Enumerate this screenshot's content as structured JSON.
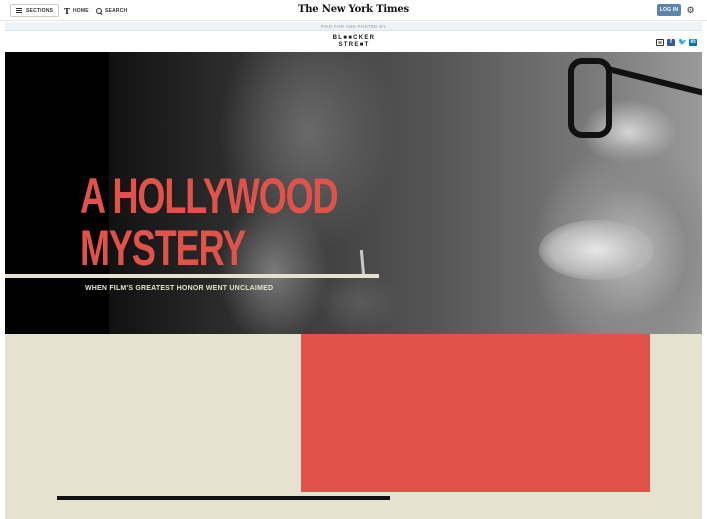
{
  "topnav": {
    "sections_label": "SECTIONS",
    "home_label": "HOME",
    "search_label": "SEARCH",
    "logo_text": "The New York Times",
    "login_label": "LOG IN",
    "gear_icon": "gear-icon"
  },
  "banner": {
    "paid_text": "PAID FOR AND POSTED BY"
  },
  "sponsor": {
    "line1": "BL■■CKER",
    "line2": "STRE■T"
  },
  "share": {
    "mail_icon": "mail-icon",
    "facebook": "f",
    "twitter": "•",
    "linkedin": "in"
  },
  "hero": {
    "headline_line1": "A HOLLYWOOD",
    "headline_line2": "MYSTERY",
    "subhead": "WHEN FILM'S GREATEST HONOR WENT UNCLAIMED"
  },
  "colors": {
    "accent_red": "#e0524a",
    "cream": "#e5e2d0",
    "login_blue": "#5a83ad"
  }
}
